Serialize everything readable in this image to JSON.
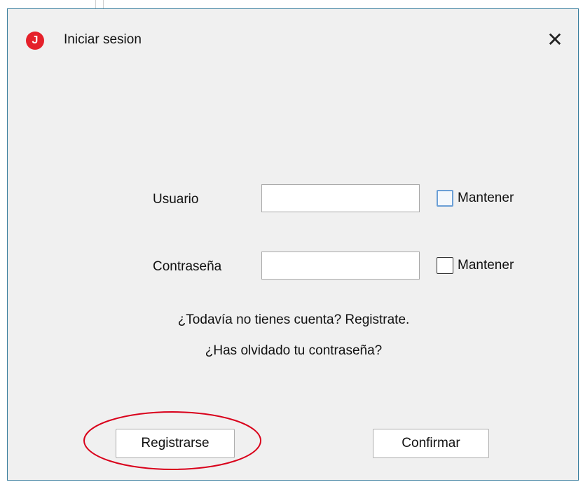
{
  "window": {
    "title": "Iniciar sesion",
    "app_icon": "J",
    "app_icon_name": "java-logo-icon",
    "accent": "#e5202a",
    "close_glyph": "✕"
  },
  "form": {
    "user_label": "Usuario",
    "user_value": "",
    "password_label": "Contraseña",
    "password_value": "",
    "keep_user_label": "Mantener",
    "keep_password_label": "Mantener"
  },
  "links": {
    "register": "¿Todavía no tienes cuenta? Registrate.",
    "forgot": "¿Has olvidado tu contraseña?"
  },
  "buttons": {
    "register": "Registrarse",
    "confirm": "Confirmar"
  },
  "annotation": {
    "highlight_color": "#d9001b"
  }
}
